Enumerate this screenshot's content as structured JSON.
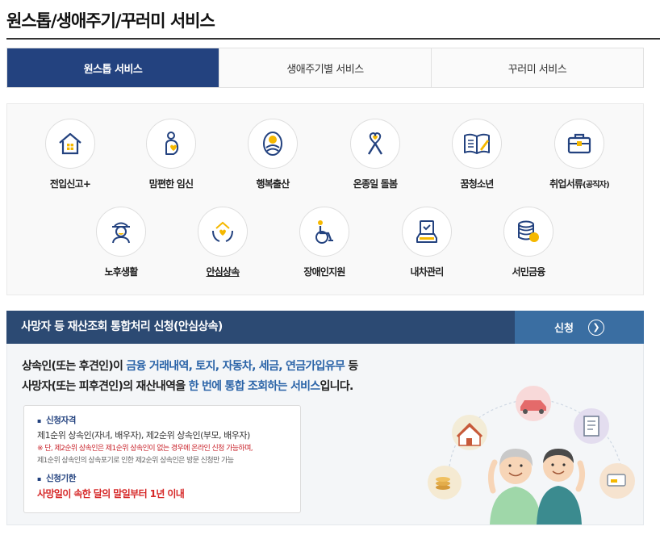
{
  "page": {
    "title": "원스톱/생애주기/꾸러미 서비스"
  },
  "tabs": [
    {
      "label": "원스톱 서비스",
      "active": true
    },
    {
      "label": "생애주기별 서비스",
      "active": false
    },
    {
      "label": "꾸러미 서비스",
      "active": false
    }
  ],
  "services": [
    {
      "label": "전입신고+",
      "icon": "house-icon"
    },
    {
      "label": "맘편한 임신",
      "icon": "pregnancy-icon"
    },
    {
      "label": "행복출산",
      "icon": "baby-icon"
    },
    {
      "label": "온종일 돌봄",
      "icon": "care-ribbon-icon"
    },
    {
      "label": "꿈청소년",
      "icon": "book-icon"
    },
    {
      "label": "취업서류",
      "label_sub": "(공직자)",
      "icon": "briefcase-icon"
    },
    {
      "label": "노후생활",
      "icon": "elder-icon"
    },
    {
      "label": "안심상속",
      "icon": "inheritance-hands-icon",
      "selected": true
    },
    {
      "label": "장애인지원",
      "icon": "wheelchair-icon"
    },
    {
      "label": "내차관리",
      "icon": "car-document-icon"
    },
    {
      "label": "서민금융",
      "icon": "coins-icon"
    }
  ],
  "detail": {
    "title": "사망자 등 재산조회 통합처리 신청(안심상속)",
    "apply_label": "신청",
    "desc1_a": "상속인(또는 후견인)이 ",
    "desc1_hl": "금융 거래내역, 토지, 자동차, 세금, 연금가입유무",
    "desc1_b": " 등",
    "desc2_a": "사망자(또는 피후견인)의 재산내역을 ",
    "desc2_hl": "한 번에 통합 조회하는 서비스",
    "desc2_b": "입니다.",
    "qual_heading": "신청자격",
    "qual_text": "제1순위 상속인(자녀, 배우자), 제2순위 상속인(부모, 배우자)",
    "qual_note1": "※ 단, 제2순위 상속인은 제1순위 상속인이 없는 경우에 온라인 신청 가능하며,",
    "qual_note2": "제1순위 상속인의 상속포기로 인한 제2순위 상속인은 방문 신청만 가능",
    "deadline_heading": "신청기한",
    "deadline_text": "사망일이 속한 달의 말일부터 1년 이내"
  },
  "colors": {
    "primary": "#23427f",
    "header_bar": "#2c4a73",
    "apply_bg": "#3a6ea2",
    "highlight": "#2b64a8",
    "deadline": "#d62828",
    "icon_accent": "#f5b800"
  }
}
